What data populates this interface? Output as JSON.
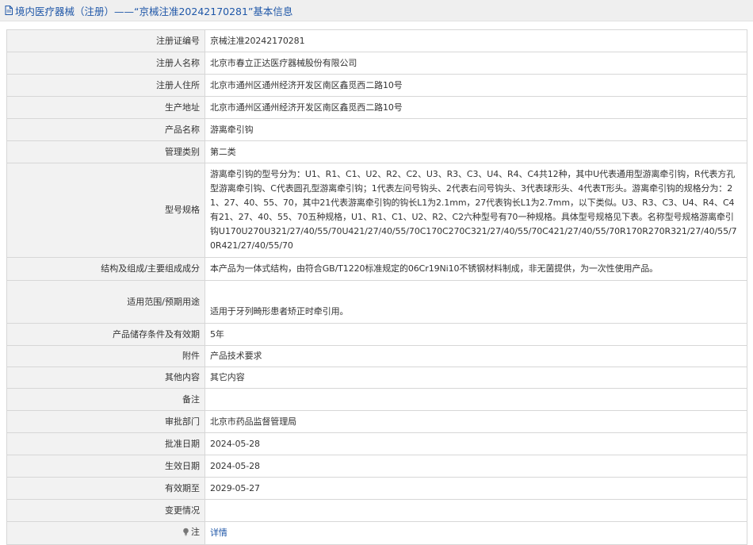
{
  "header": {
    "title": "境内医疗器械（注册）——“京械注准20242170281”基本信息",
    "icon": "document-icon"
  },
  "rows": [
    {
      "label": "注册证编号",
      "value": "京械注准20242170281"
    },
    {
      "label": "注册人名称",
      "value": "北京市春立正达医疗器械股份有限公司"
    },
    {
      "label": "注册人住所",
      "value": "北京市通州区通州经济开发区南区鑫觅西二路10号"
    },
    {
      "label": "生产地址",
      "value": "北京市通州区通州经济开发区南区鑫觅西二路10号"
    },
    {
      "label": "产品名称",
      "value": "游离牵引钩"
    },
    {
      "label": "管理类别",
      "value": "第二类"
    },
    {
      "label": "型号规格",
      "value": "游离牵引钩的型号分为：U1、R1、C1、U2、R2、C2、U3、R3、C3、U4、R4、C4共12种，其中U代表通用型游离牵引钩，R代表方孔型游离牵引钩、C代表圆孔型游离牵引钩；1代表左问号钩头、2代表右问号钩头、3代表球形头、4代表T形头。游离牵引钩的规格分为：21、27、40、55、70，其中21代表游离牵引钩的钩长L1为2.1mm，27代表钩长L1为2.7mm，以下类似。U3、R3、C3、U4、R4、C4有21、27、40、55、70五种规格，U1、R1、C1、U2、R2、C2六种型号有70一种规格。具体型号规格见下表。名称型号规格游离牵引钩U170U270U321/27/40/55/70U421/27/40/55/70C170C270C321/27/40/55/70C421/27/40/55/70R170R270R321/27/40/55/70R421/27/40/55/70"
    },
    {
      "label": "结构及组成/主要组成成分",
      "value": "本产品为一体式结构，由符合GB/T1220标准规定的06Cr19Ni10不锈钢材料制成，非无菌提供，为一次性使用产品。"
    },
    {
      "label": "适用范围/预期用途",
      "value": "适用于牙列畸形患者矫正时牵引用。"
    },
    {
      "label": "产品储存条件及有效期",
      "value": "5年"
    },
    {
      "label": "附件",
      "value": "产品技术要求"
    },
    {
      "label": "其他内容",
      "value": "其它内容"
    },
    {
      "label": "备注",
      "value": ""
    },
    {
      "label": "审批部门",
      "value": "北京市药品监督管理局"
    },
    {
      "label": "批准日期",
      "value": "2024-05-28"
    },
    {
      "label": "生效日期",
      "value": "2024-05-28"
    },
    {
      "label": "有效期至",
      "value": "2029-05-27"
    },
    {
      "label": "变更情况",
      "value": ""
    }
  ],
  "note": {
    "label": "注",
    "icon": "lightbulb-icon",
    "link_text": "详情",
    "link_color": "#1f57a8"
  }
}
